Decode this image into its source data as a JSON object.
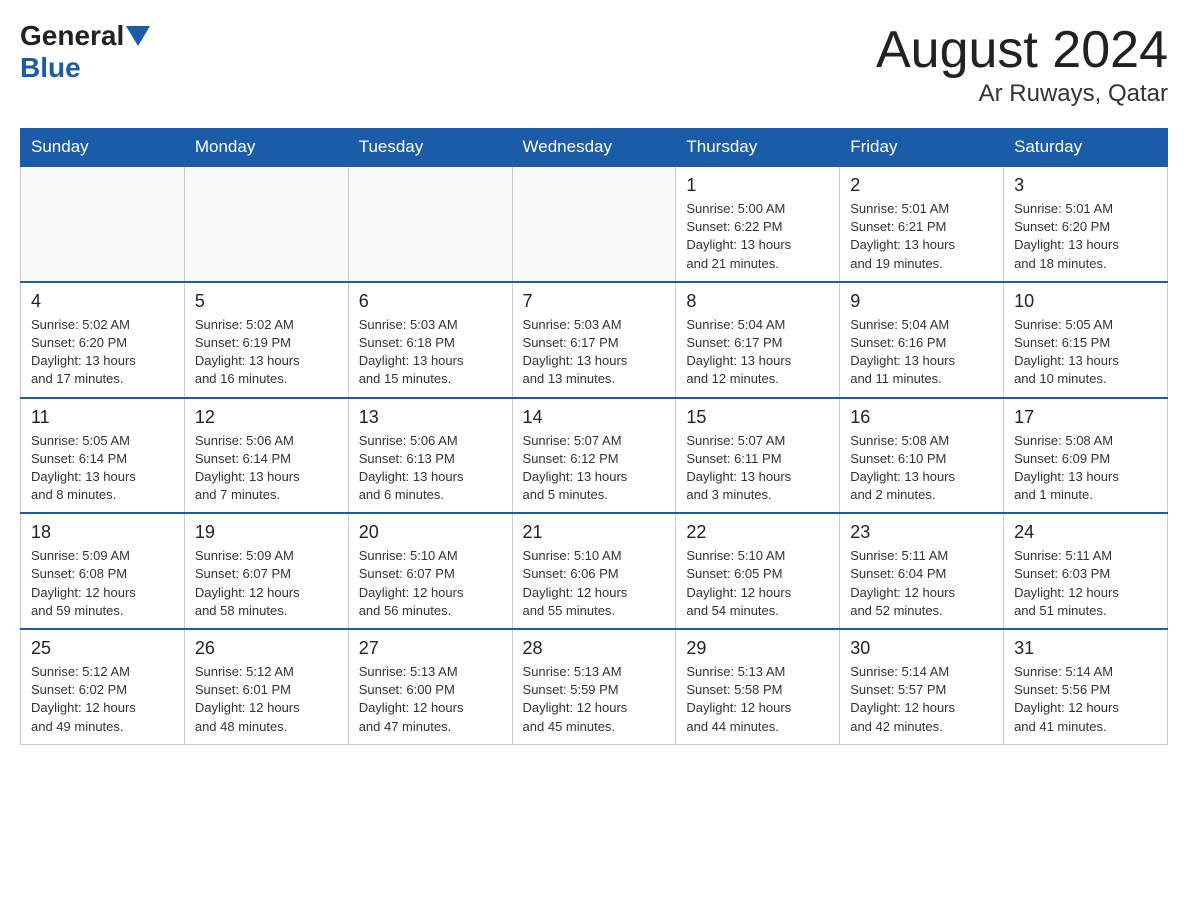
{
  "header": {
    "logo_general": "General",
    "logo_blue": "Blue",
    "month_title": "August 2024",
    "location": "Ar Ruways, Qatar"
  },
  "days_of_week": [
    "Sunday",
    "Monday",
    "Tuesday",
    "Wednesday",
    "Thursday",
    "Friday",
    "Saturday"
  ],
  "weeks": [
    {
      "days": [
        {
          "num": "",
          "info": "",
          "empty": true
        },
        {
          "num": "",
          "info": "",
          "empty": true
        },
        {
          "num": "",
          "info": "",
          "empty": true
        },
        {
          "num": "",
          "info": "",
          "empty": true
        },
        {
          "num": "1",
          "info": "Sunrise: 5:00 AM\nSunset: 6:22 PM\nDaylight: 13 hours\nand 21 minutes.",
          "empty": false
        },
        {
          "num": "2",
          "info": "Sunrise: 5:01 AM\nSunset: 6:21 PM\nDaylight: 13 hours\nand 19 minutes.",
          "empty": false
        },
        {
          "num": "3",
          "info": "Sunrise: 5:01 AM\nSunset: 6:20 PM\nDaylight: 13 hours\nand 18 minutes.",
          "empty": false
        }
      ]
    },
    {
      "days": [
        {
          "num": "4",
          "info": "Sunrise: 5:02 AM\nSunset: 6:20 PM\nDaylight: 13 hours\nand 17 minutes.",
          "empty": false
        },
        {
          "num": "5",
          "info": "Sunrise: 5:02 AM\nSunset: 6:19 PM\nDaylight: 13 hours\nand 16 minutes.",
          "empty": false
        },
        {
          "num": "6",
          "info": "Sunrise: 5:03 AM\nSunset: 6:18 PM\nDaylight: 13 hours\nand 15 minutes.",
          "empty": false
        },
        {
          "num": "7",
          "info": "Sunrise: 5:03 AM\nSunset: 6:17 PM\nDaylight: 13 hours\nand 13 minutes.",
          "empty": false
        },
        {
          "num": "8",
          "info": "Sunrise: 5:04 AM\nSunset: 6:17 PM\nDaylight: 13 hours\nand 12 minutes.",
          "empty": false
        },
        {
          "num": "9",
          "info": "Sunrise: 5:04 AM\nSunset: 6:16 PM\nDaylight: 13 hours\nand 11 minutes.",
          "empty": false
        },
        {
          "num": "10",
          "info": "Sunrise: 5:05 AM\nSunset: 6:15 PM\nDaylight: 13 hours\nand 10 minutes.",
          "empty": false
        }
      ]
    },
    {
      "days": [
        {
          "num": "11",
          "info": "Sunrise: 5:05 AM\nSunset: 6:14 PM\nDaylight: 13 hours\nand 8 minutes.",
          "empty": false
        },
        {
          "num": "12",
          "info": "Sunrise: 5:06 AM\nSunset: 6:14 PM\nDaylight: 13 hours\nand 7 minutes.",
          "empty": false
        },
        {
          "num": "13",
          "info": "Sunrise: 5:06 AM\nSunset: 6:13 PM\nDaylight: 13 hours\nand 6 minutes.",
          "empty": false
        },
        {
          "num": "14",
          "info": "Sunrise: 5:07 AM\nSunset: 6:12 PM\nDaylight: 13 hours\nand 5 minutes.",
          "empty": false
        },
        {
          "num": "15",
          "info": "Sunrise: 5:07 AM\nSunset: 6:11 PM\nDaylight: 13 hours\nand 3 minutes.",
          "empty": false
        },
        {
          "num": "16",
          "info": "Sunrise: 5:08 AM\nSunset: 6:10 PM\nDaylight: 13 hours\nand 2 minutes.",
          "empty": false
        },
        {
          "num": "17",
          "info": "Sunrise: 5:08 AM\nSunset: 6:09 PM\nDaylight: 13 hours\nand 1 minute.",
          "empty": false
        }
      ]
    },
    {
      "days": [
        {
          "num": "18",
          "info": "Sunrise: 5:09 AM\nSunset: 6:08 PM\nDaylight: 12 hours\nand 59 minutes.",
          "empty": false
        },
        {
          "num": "19",
          "info": "Sunrise: 5:09 AM\nSunset: 6:07 PM\nDaylight: 12 hours\nand 58 minutes.",
          "empty": false
        },
        {
          "num": "20",
          "info": "Sunrise: 5:10 AM\nSunset: 6:07 PM\nDaylight: 12 hours\nand 56 minutes.",
          "empty": false
        },
        {
          "num": "21",
          "info": "Sunrise: 5:10 AM\nSunset: 6:06 PM\nDaylight: 12 hours\nand 55 minutes.",
          "empty": false
        },
        {
          "num": "22",
          "info": "Sunrise: 5:10 AM\nSunset: 6:05 PM\nDaylight: 12 hours\nand 54 minutes.",
          "empty": false
        },
        {
          "num": "23",
          "info": "Sunrise: 5:11 AM\nSunset: 6:04 PM\nDaylight: 12 hours\nand 52 minutes.",
          "empty": false
        },
        {
          "num": "24",
          "info": "Sunrise: 5:11 AM\nSunset: 6:03 PM\nDaylight: 12 hours\nand 51 minutes.",
          "empty": false
        }
      ]
    },
    {
      "days": [
        {
          "num": "25",
          "info": "Sunrise: 5:12 AM\nSunset: 6:02 PM\nDaylight: 12 hours\nand 49 minutes.",
          "empty": false
        },
        {
          "num": "26",
          "info": "Sunrise: 5:12 AM\nSunset: 6:01 PM\nDaylight: 12 hours\nand 48 minutes.",
          "empty": false
        },
        {
          "num": "27",
          "info": "Sunrise: 5:13 AM\nSunset: 6:00 PM\nDaylight: 12 hours\nand 47 minutes.",
          "empty": false
        },
        {
          "num": "28",
          "info": "Sunrise: 5:13 AM\nSunset: 5:59 PM\nDaylight: 12 hours\nand 45 minutes.",
          "empty": false
        },
        {
          "num": "29",
          "info": "Sunrise: 5:13 AM\nSunset: 5:58 PM\nDaylight: 12 hours\nand 44 minutes.",
          "empty": false
        },
        {
          "num": "30",
          "info": "Sunrise: 5:14 AM\nSunset: 5:57 PM\nDaylight: 12 hours\nand 42 minutes.",
          "empty": false
        },
        {
          "num": "31",
          "info": "Sunrise: 5:14 AM\nSunset: 5:56 PM\nDaylight: 12 hours\nand 41 minutes.",
          "empty": false
        }
      ]
    }
  ]
}
